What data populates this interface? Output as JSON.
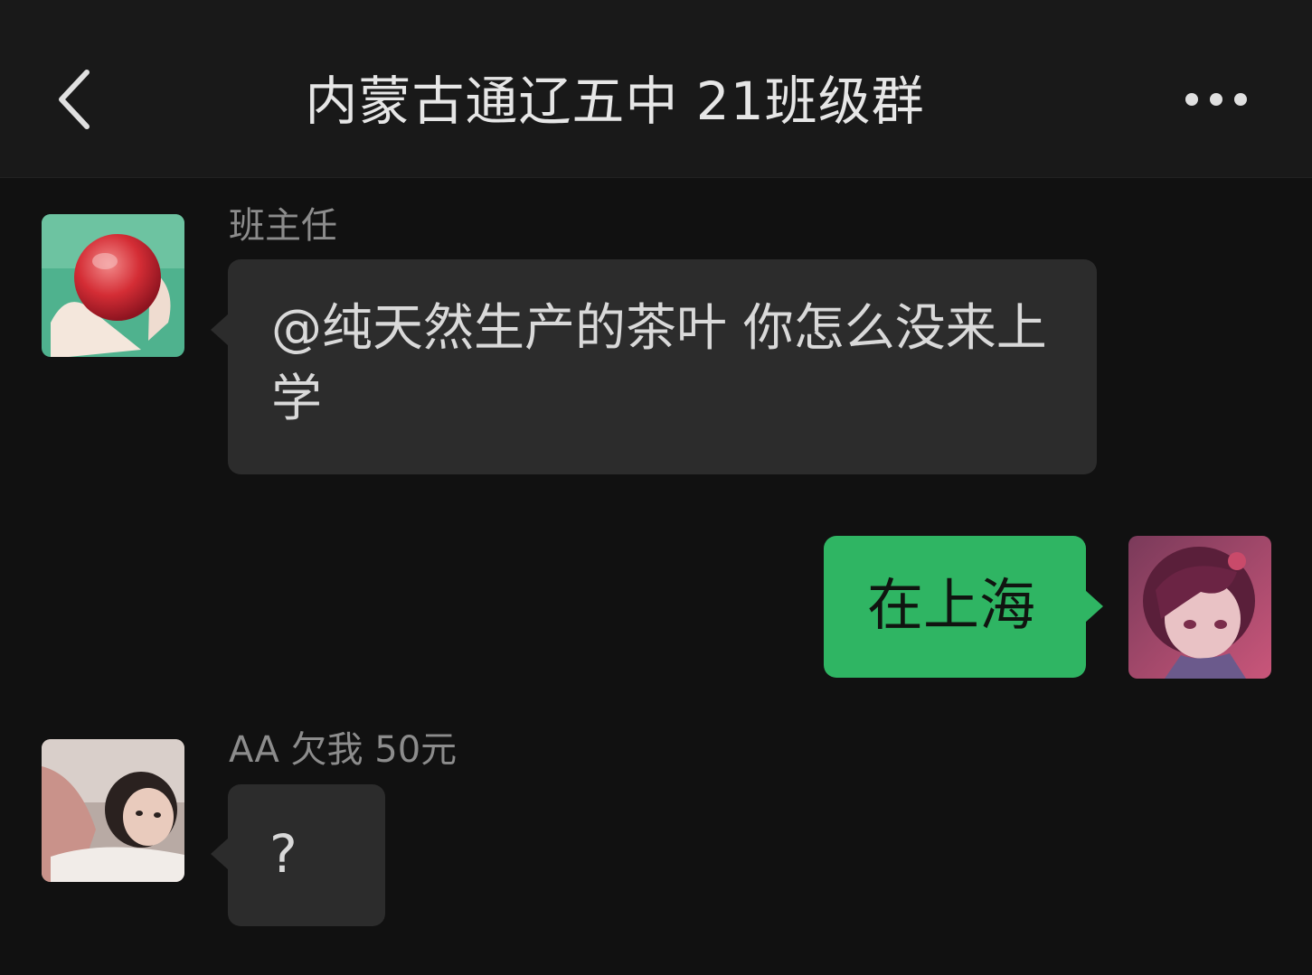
{
  "header": {
    "title": "内蒙古通辽五中 21班级群",
    "back_icon": "chevron-left-icon",
    "more_icon": "ellipsis-icon"
  },
  "messages": [
    {
      "sender": "班主任",
      "avatar": "apple-avatar",
      "text": "@纯天然生产的茶叶 你怎么没来上学",
      "side": "left"
    },
    {
      "sender": "",
      "avatar": "anime-girl-avatar",
      "text": "在上海",
      "side": "right"
    },
    {
      "sender": "AA 欠我 50元",
      "avatar": "woman-photo-avatar",
      "text": "?",
      "side": "left"
    }
  ],
  "colors": {
    "background": "#111111",
    "header": "#191919",
    "incoming_bubble": "#2c2c2c",
    "outgoing_bubble": "#2fb563"
  }
}
